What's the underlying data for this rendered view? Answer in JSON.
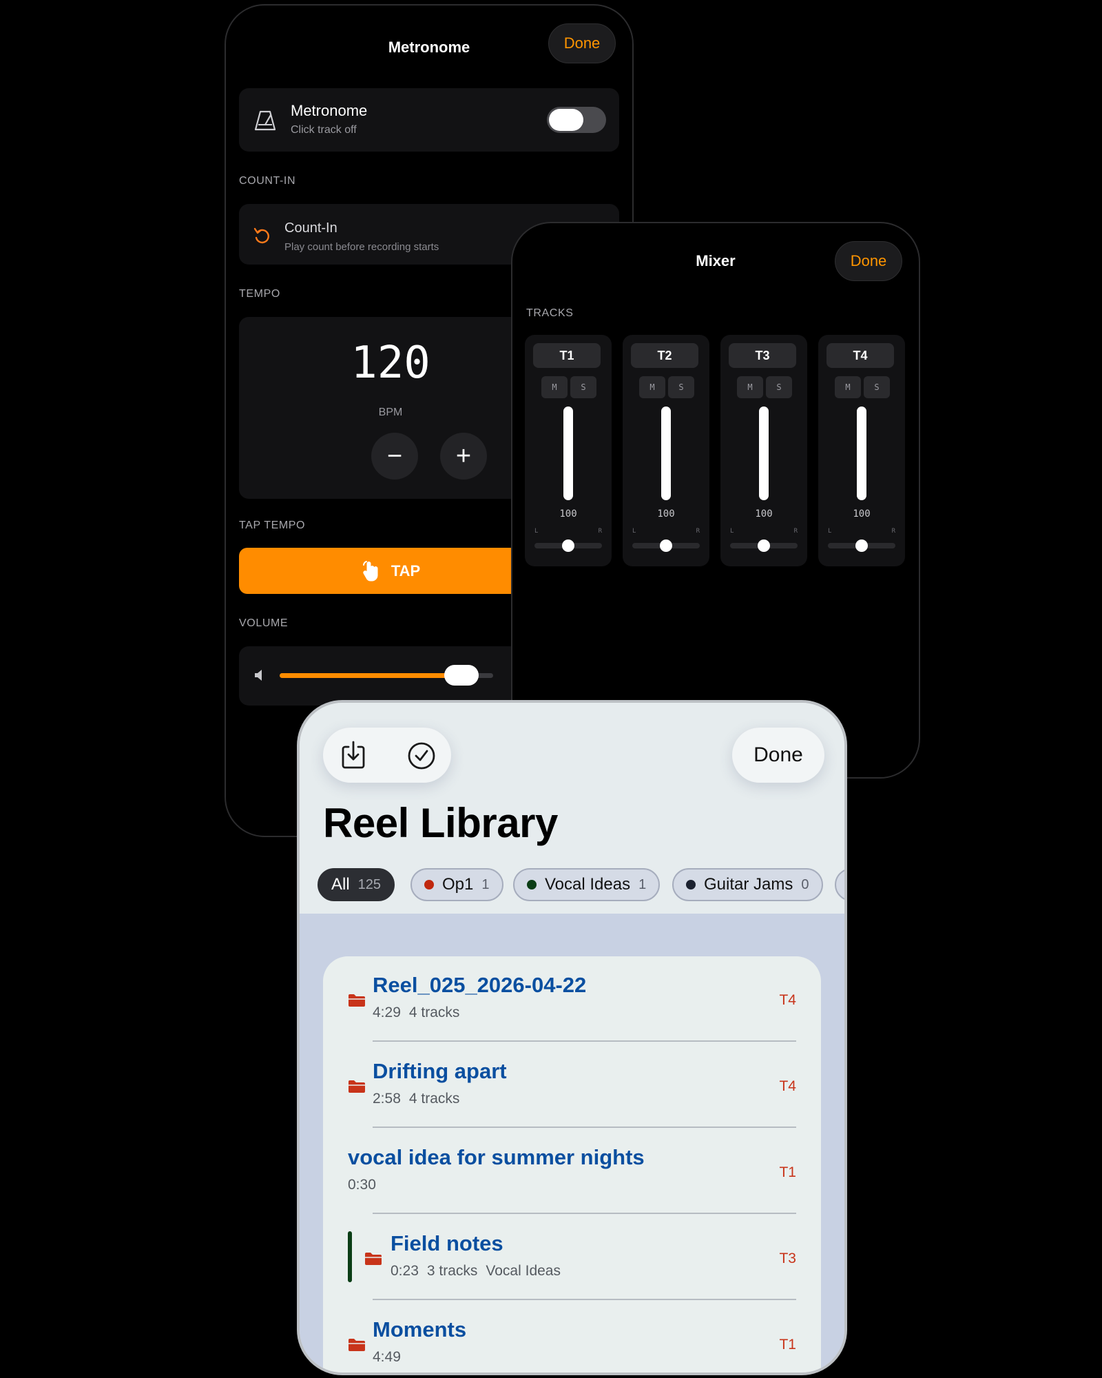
{
  "metronome": {
    "title": "Metronome",
    "done_label": "Done",
    "toggle_row": {
      "title": "Metronome",
      "subtitle": "Click track off",
      "enabled": false
    },
    "count_in_section": "COUNT-IN",
    "count_in_row": {
      "title": "Count-In",
      "subtitle": "Play count before recording starts"
    },
    "tempo_section": "TEMPO",
    "tempo": {
      "value": "120",
      "unit": "BPM",
      "decrement": "−",
      "increment": "+"
    },
    "tap_section": "TAP TEMPO",
    "tap_label": "TAP",
    "volume_section": "VOLUME",
    "volume_level": 0.85,
    "accent_color": "#ff8c00"
  },
  "mixer": {
    "title": "Mixer",
    "done_label": "Done",
    "tracks_section": "TRACKS",
    "mute_label": "M",
    "solo_label": "S",
    "left_label": "L",
    "right_label": "R",
    "tracks": [
      {
        "name": "T1",
        "volume": "100",
        "level": 1.0,
        "pan": 0.5
      },
      {
        "name": "T2",
        "volume": "100",
        "level": 1.0,
        "pan": 0.5
      },
      {
        "name": "T3",
        "volume": "100",
        "level": 1.0,
        "pan": 0.5
      },
      {
        "name": "T4",
        "volume": "100",
        "level": 1.0,
        "pan": 0.5
      }
    ]
  },
  "library": {
    "title": "Reel Library",
    "done_label": "Done",
    "icons": [
      "download-icon",
      "select-check-icon"
    ],
    "filters": [
      {
        "label": "All",
        "count": "125",
        "active": true,
        "color": ""
      },
      {
        "label": "Op1",
        "count": "1",
        "active": false,
        "color": "#c0280f"
      },
      {
        "label": "Vocal Ideas",
        "count": "1",
        "active": false,
        "color": "#0b3e16"
      },
      {
        "label": "Guitar Jams",
        "count": "0",
        "active": false,
        "color": "#1c2230"
      }
    ],
    "items": [
      {
        "title": "Reel_025_2026-04-22",
        "duration": "4:29",
        "tracks": "4 tracks",
        "group": "",
        "badge": "T4",
        "folder": true,
        "accent": false
      },
      {
        "title": "Drifting apart",
        "duration": "2:58",
        "tracks": "4 tracks",
        "group": "",
        "badge": "T4",
        "folder": true,
        "accent": false
      },
      {
        "title": "vocal idea for summer nights",
        "duration": "0:30",
        "tracks": "",
        "group": "",
        "badge": "T1",
        "folder": false,
        "accent": false
      },
      {
        "title": "Field notes",
        "duration": "0:23",
        "tracks": "3 tracks",
        "group": "Vocal Ideas",
        "badge": "T3",
        "folder": true,
        "accent": true
      },
      {
        "title": "Moments",
        "duration": "4:49",
        "tracks": "",
        "group": "",
        "badge": "T1",
        "folder": true,
        "accent": false
      }
    ]
  }
}
